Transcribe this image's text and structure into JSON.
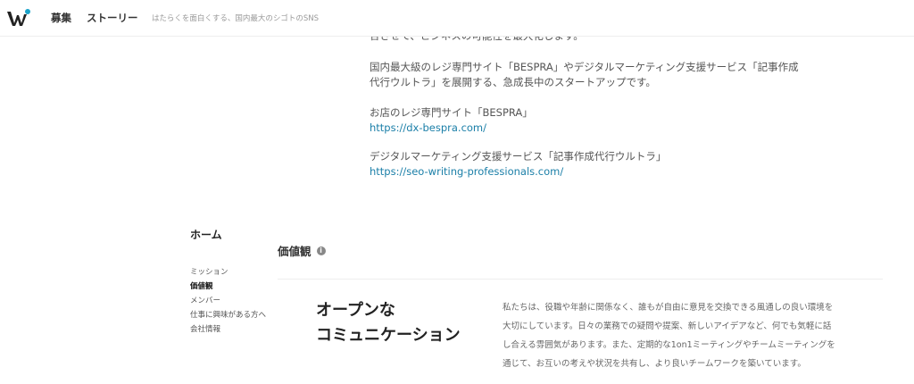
{
  "header": {
    "nav": [
      "募集",
      "ストーリー"
    ],
    "tagline": "はたらくを面白くする、国内最大のシゴトのSNS",
    "accent_color": "#1aa3c9"
  },
  "description": {
    "partial_line": "合させて、ビジネスの可能性を最大化します。",
    "intro_lines": [
      "国内最大級のレジ専門サイト「BESPRA」やデジタルマーケティング支援サービス「記事作成",
      "代行ウルトラ」を展開する、急成長中のスタートアップです。"
    ],
    "site1_label": "お店のレジ専門サイト「BESPRA」",
    "site1_url": "https://dx-bespra.com/",
    "site2_label": "デジタルマーケティング支援サービス「記事作成代行ウルトラ」",
    "site2_url": "https://seo-writing-professionals.com/"
  },
  "sidebar": {
    "title": "ホーム",
    "items": [
      "ミッション",
      "価値観",
      "メンバー",
      "仕事に興味がある方へ",
      "会社情報"
    ],
    "active_index": 1
  },
  "values": {
    "heading": "価値観",
    "info_icon": "i",
    "item_title_lines": [
      "オープンな",
      "コミュニケーション"
    ],
    "item_body_lines": [
      "私たちは、役職や年齢に関係なく、誰もが自由に意見を交換できる風通しの良い環境を",
      "大切にしています。日々の業務での疑問や提案、新しいアイデアなど、何でも気軽に話",
      "し合える雰囲気があります。また、定期的な1on1ミーティングやチームミーティングを",
      "通じて、お互いの考えや状況を共有し、より良いチームワークを築いています。"
    ]
  }
}
